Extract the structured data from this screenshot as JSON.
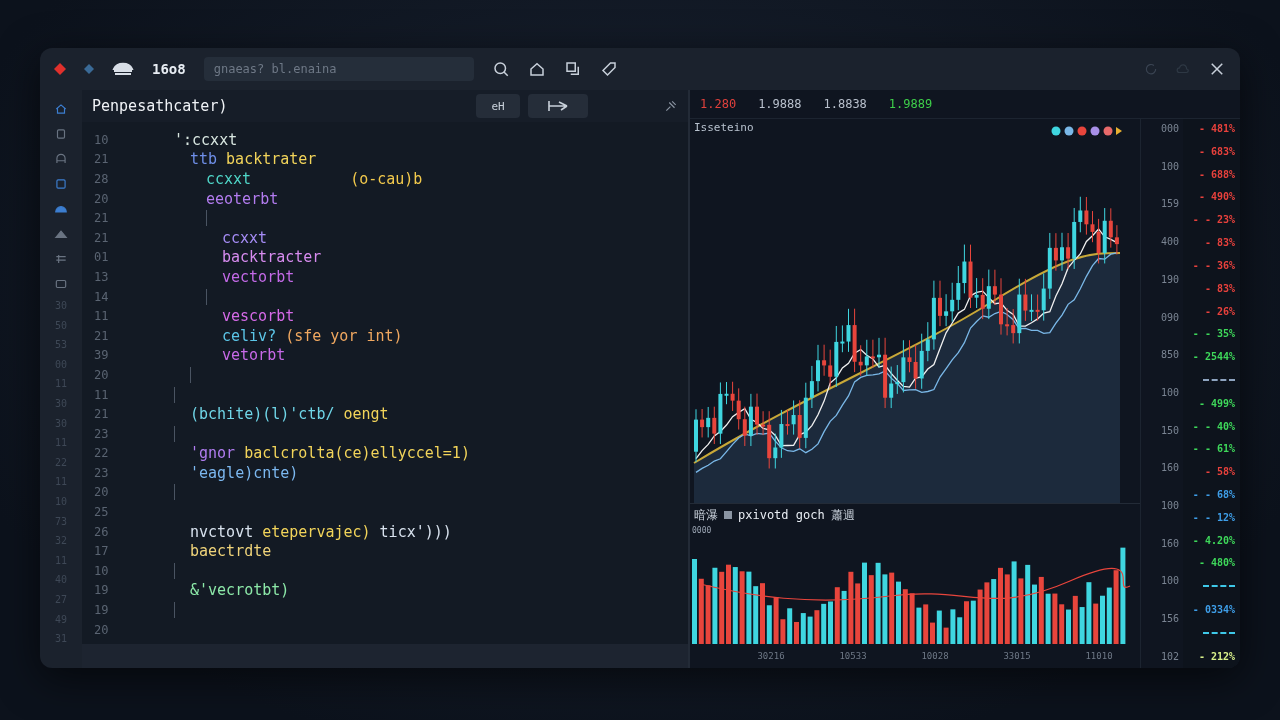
{
  "toolbar": {
    "title": "16o8",
    "search": {
      "placeholder": "gnaeas? bl.enaina"
    }
  },
  "rail": {
    "numbers": [
      "30",
      "50",
      "53",
      "00",
      "11",
      "30",
      "30",
      "11",
      "22",
      "11",
      "10",
      "73",
      "32",
      "11",
      "40",
      "27",
      "49",
      "31"
    ]
  },
  "editor": {
    "title": "Penpesathcater)",
    "buttons": [
      {
        "label": "eH"
      }
    ],
    "lines": [
      {
        "number": "10",
        "guide": false,
        "tokens": [
          {
            "text": "':ccxxt",
            "color": "#d8e6e0"
          }
        ],
        "children": [
          {
            "number": "21",
            "guide": false,
            "tokens": [
              {
                "text": "ttb",
                "color": "#6f8fe8"
              },
              {
                "text": "backtrater",
                "color": "#f2d45a"
              }
            ],
            "children": [
              {
                "number": "28",
                "guide": false,
                "tokens": [
                  {
                    "text": "ccxxt",
                    "color": "#4fd6c8"
                  },
                  {
                    "text": "(o-cau)b",
                    "color": "#f2c94c",
                    "gap": true
                  }
                ]
              },
              {
                "number": "20",
                "guide": false,
                "tokens": [
                  {
                    "text": "eeoterbt",
                    "color": "#b37cf0"
                  }
                ]
              },
              {
                "number": "21",
                "guide": true,
                "children": [
                  {
                    "number": "21",
                    "guide": false,
                    "tokens": [
                      {
                        "text": "ccxxt",
                        "color": "#a58cf5"
                      }
                    ]
                  },
                  {
                    "number": "01",
                    "guide": false,
                    "tokens": [
                      {
                        "text": "backtracter",
                        "color": "#d88cf0"
                      }
                    ]
                  },
                  {
                    "number": "13",
                    "guide": false,
                    "tokens": [
                      {
                        "text": "vectorbt",
                        "color": "#c46ae8"
                      }
                    ]
                  }
                ]
              },
              {
                "number": "14",
                "guide": true,
                "children": [
                  {
                    "number": "11",
                    "guide": false,
                    "tokens": [
                      {
                        "text": "vescorbt",
                        "color": "#d66ae8"
                      }
                    ]
                  },
                  {
                    "number": "21",
                    "guide": false,
                    "tokens": [
                      {
                        "text": "celiv?",
                        "color": "#5cc6e8"
                      },
                      {
                        "text": "(sfe yor int)",
                        "color": "#f0a860"
                      }
                    ]
                  },
                  {
                    "number": "39",
                    "guide": false,
                    "tokens": [
                      {
                        "text": "vetorbt",
                        "color": "#c86ae8"
                      }
                    ]
                  }
                ]
              }
            ]
          },
          {
            "number": "20",
            "guide": true
          }
        ]
      },
      {
        "number": "11",
        "guide": true,
        "children": [
          {
            "number": "21",
            "guide": false,
            "tokens": [
              {
                "text": "(bchite)(l)'ctb/",
                "color": "#6fd6e8"
              },
              {
                "text": "oengt",
                "color": "#f2d45a"
              }
            ]
          }
        ]
      },
      {
        "number": "23",
        "guide": true,
        "children": [
          {
            "number": "22",
            "guide": false,
            "tokens": [
              {
                "text": "'gnor",
                "color": "#b07cf0"
              },
              {
                "text": "baclcrolta(ce)ellyccel=1)",
                "color": "#f2d45a"
              }
            ]
          },
          {
            "number": "23",
            "guide": false,
            "tokens": [
              {
                "text": "'eagle)cnte)",
                "color": "#7cb8f0"
              }
            ]
          }
        ]
      },
      {
        "number": "20",
        "guide": true,
        "children": [
          {
            "number": "25",
            "guide": false
          },
          {
            "number": "26",
            "guide": false,
            "tokens": [
              {
                "text": "nvctovt",
                "color": "#d8e2ee"
              },
              {
                "text": "etepervajec)",
                "color": "#f2d45a"
              },
              {
                "text": "ticx')))",
                "color": "#d8e2ee"
              }
            ]
          },
          {
            "number": "17",
            "guide": false,
            "tokens": [
              {
                "text": "baectrdte",
                "color": "#f0d47a"
              }
            ]
          }
        ]
      },
      {
        "number": "10",
        "guide": true,
        "children": [
          {
            "number": "19",
            "guide": false,
            "tokens": [
              {
                "text": "&'vecrotbt)",
                "color": "#8ce8a8"
              }
            ]
          }
        ]
      },
      {
        "number": "19",
        "guide": true
      },
      {
        "number": "20",
        "guide": false
      }
    ]
  },
  "quotes": [
    {
      "text": "1.280",
      "color": "#e0413c"
    },
    {
      "text": "1.9888",
      "color": "#b8c0cc"
    },
    {
      "text": "1.8838",
      "color": "#b8c0cc"
    },
    {
      "text": "1.9889",
      "color": "#3ecf4a"
    }
  ],
  "chart": {
    "label": "Isseteino"
  },
  "axis": [
    "000",
    "100",
    "159",
    "400",
    "190",
    "090",
    "850",
    "100",
    "150",
    "160",
    "100",
    "160",
    "100",
    "156",
    "102"
  ],
  "changes": [
    {
      "kind": "text",
      "text": "- 481%",
      "color": "#e8413c"
    },
    {
      "kind": "text",
      "text": "- 683%",
      "color": "#e8413c"
    },
    {
      "kind": "text",
      "text": "- 688%",
      "color": "#e8413c"
    },
    {
      "kind": "text",
      "text": "- 490%",
      "color": "#e8413c"
    },
    {
      "kind": "text",
      "text": "- - 23%",
      "color": "#e8413c"
    },
    {
      "kind": "text",
      "text": "- 83%",
      "color": "#e8413c"
    },
    {
      "kind": "text",
      "text": "- - 36%",
      "color": "#e8413c"
    },
    {
      "kind": "text",
      "text": "- 83%",
      "color": "#e8413c"
    },
    {
      "kind": "text",
      "text": "- 26%",
      "color": "#e8413c"
    },
    {
      "kind": "text",
      "text": "- - 35%",
      "color": "#3ed85a"
    },
    {
      "kind": "text",
      "text": "- 2544%",
      "color": "#3ed85a"
    },
    {
      "kind": "dash",
      "color": "#8ea4c0"
    },
    {
      "kind": "text",
      "text": "- 499%",
      "color": "#3ed85a"
    },
    {
      "kind": "text",
      "text": "- - 40%",
      "color": "#3ed85a"
    },
    {
      "kind": "text",
      "text": "- - 61%",
      "color": "#3ed85a"
    },
    {
      "kind": "text",
      "text": "- 58%",
      "color": "#e8413c"
    },
    {
      "kind": "text",
      "text": "- - 68%",
      "color": "#3e9ee8"
    },
    {
      "kind": "text",
      "text": "- - 12%",
      "color": "#3e9ee8"
    },
    {
      "kind": "text",
      "text": "- 4.20%",
      "color": "#3ed85a"
    },
    {
      "kind": "text",
      "text": "- 480%",
      "color": "#3ed85a"
    },
    {
      "kind": "dash",
      "color": "#3ec8e8"
    },
    {
      "kind": "text",
      "text": "- 0334%",
      "color": "#3e9ee8"
    },
    {
      "kind": "dash",
      "color": "#3ec8e8"
    },
    {
      "kind": "text",
      "text": "- 212%",
      "color": "#d8f08a"
    }
  ],
  "volume": {
    "title_left": "暗瀑",
    "title": "pxivotd goch",
    "title_right": "蕭週",
    "tick": "0000"
  },
  "x_labels": [
    "30216",
    "10533",
    "10028",
    "33015",
    "11010"
  ]
}
